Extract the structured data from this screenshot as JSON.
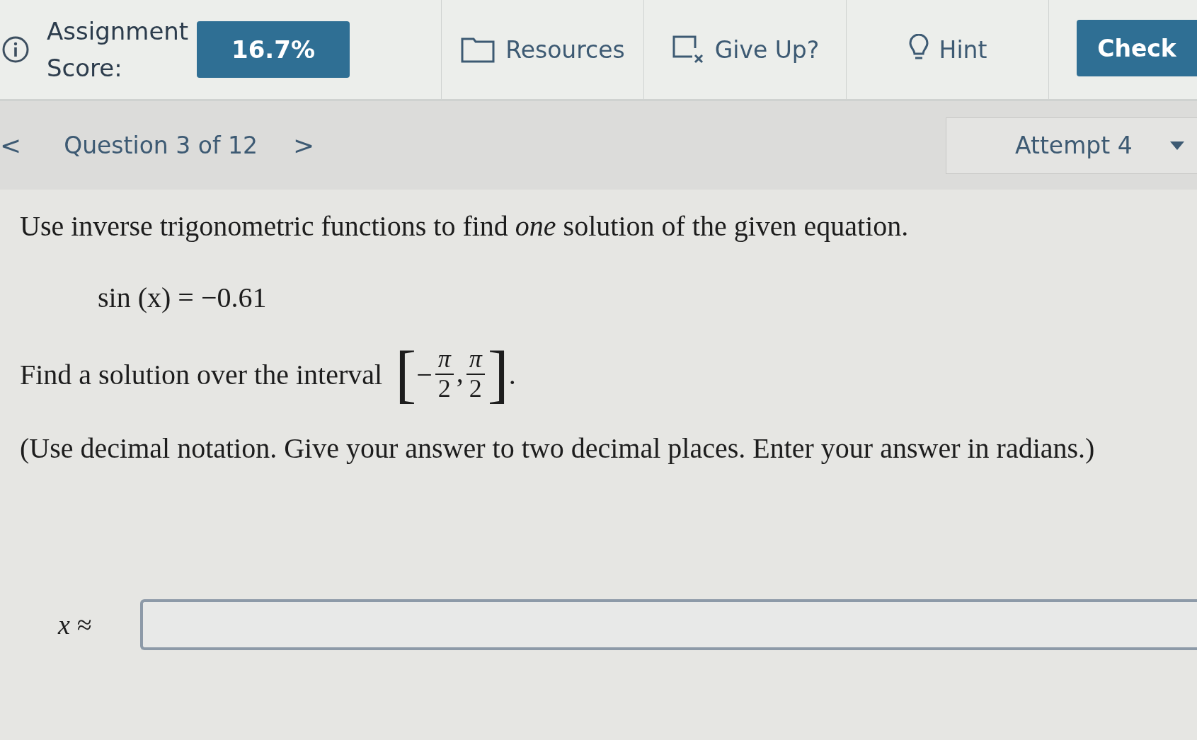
{
  "toolbar": {
    "score_label": "Assignment Score:",
    "score": "16.7%",
    "items": [
      {
        "kind": "resources",
        "label": "Resources"
      },
      {
        "kind": "giveup",
        "label": "Give Up?"
      },
      {
        "kind": "hint",
        "label": "Hint"
      }
    ],
    "check": "Check"
  },
  "nav": {
    "prev": "<",
    "question": "Question 3 of 12",
    "next": ">",
    "attempt": "Attempt 4"
  },
  "question": {
    "instruction": "Use inverse trigonometric functions to find *one* solution of the given equation.",
    "equation": "sin (x) = −0.61",
    "interval": {
      "lead": "Find a solution over the interval",
      "open": "[",
      "sign": "−",
      "lower": {
        "num": "π",
        "den": "2"
      },
      "sep": ",",
      "upper": {
        "num": "π",
        "den": "2"
      },
      "close": "]",
      "end": "."
    },
    "note": "(Use decimal notation. Give your answer to two decimal places. Enter your answer in radians.)",
    "answer_label": "x ≈"
  }
}
